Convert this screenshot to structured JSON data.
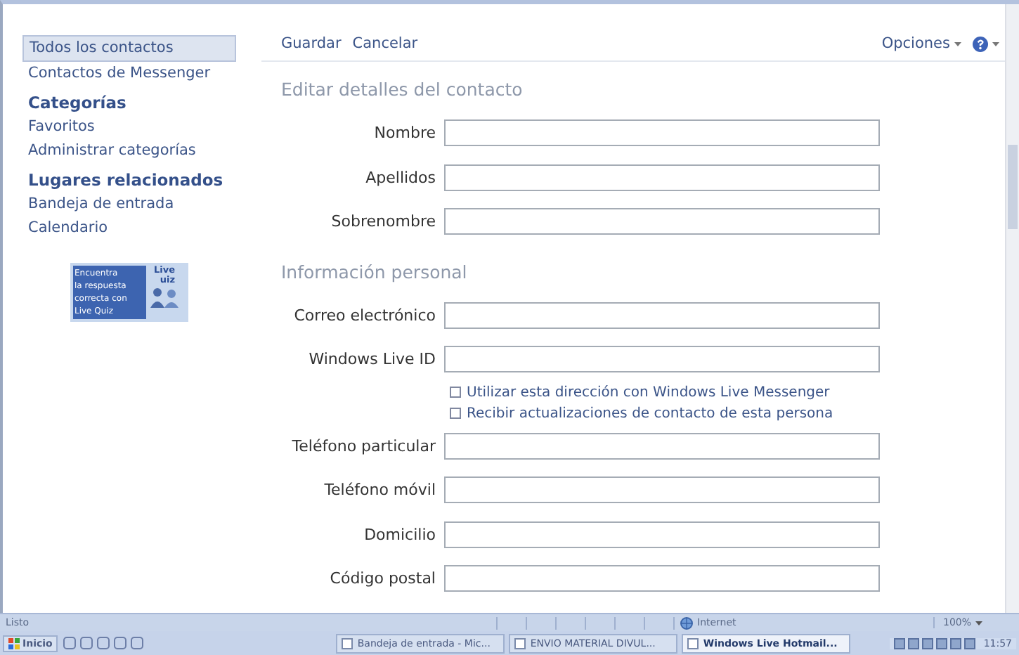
{
  "sidebar": {
    "views": [
      {
        "label": "Todos los contactos",
        "selected": true
      },
      {
        "label": "Contactos de Messenger",
        "selected": false
      }
    ],
    "groups": [
      {
        "heading": "Categorías",
        "items": [
          {
            "label": "Favoritos",
            "selected": false
          },
          {
            "label": "Administrar categorías",
            "selected": false
          }
        ]
      },
      {
        "heading": "Lugares relacionados",
        "items": [
          {
            "label": "Bandeja de entrada",
            "selected": false
          },
          {
            "label": "Calendario",
            "selected": false
          }
        ]
      }
    ],
    "ad": {
      "lines": [
        "Encuentra",
        "la respuesta",
        "correcta con",
        "Live Quiz"
      ],
      "brand": [
        "Live",
        "uiz"
      ]
    }
  },
  "toolbar": {
    "actions": [
      "Guardar",
      "Cancelar"
    ],
    "options": "Opciones"
  },
  "form": {
    "sections": [
      {
        "title": "Editar detalles del contacto",
        "rows": [
          {
            "kind": "field",
            "label": "Nombre"
          },
          {
            "kind": "field",
            "label": "Apellidos"
          },
          {
            "kind": "field",
            "label": "Sobrenombre"
          }
        ]
      },
      {
        "title": "Información personal",
        "rows": [
          {
            "kind": "field",
            "label": "Correo electrónico"
          },
          {
            "kind": "field",
            "label": "Windows Live ID"
          },
          {
            "kind": "checkbox",
            "label": "Utilizar esta dirección con Windows Live Messenger",
            "checked": false
          },
          {
            "kind": "checkbox",
            "label": "Recibir actualizaciones de contacto de esta persona",
            "checked": false
          },
          {
            "kind": "field",
            "label": "Teléfono particular"
          },
          {
            "kind": "field",
            "label": "Teléfono móvil"
          },
          {
            "kind": "field",
            "label": "Domicilio"
          },
          {
            "kind": "field",
            "label": "Código postal"
          }
        ]
      }
    ]
  },
  "status_bar": {
    "text": "Listo",
    "zone": "Internet",
    "zoom": "100%"
  },
  "taskbar": {
    "start": "Inicio",
    "tasks": [
      {
        "label": "Bandeja de entrada - Mic...",
        "selected": false
      },
      {
        "label": "ENVIO MATERIAL DIVUL...",
        "selected": false
      },
      {
        "label": "Windows Live Hotmail...",
        "selected": true
      }
    ],
    "clock": "11:57"
  }
}
